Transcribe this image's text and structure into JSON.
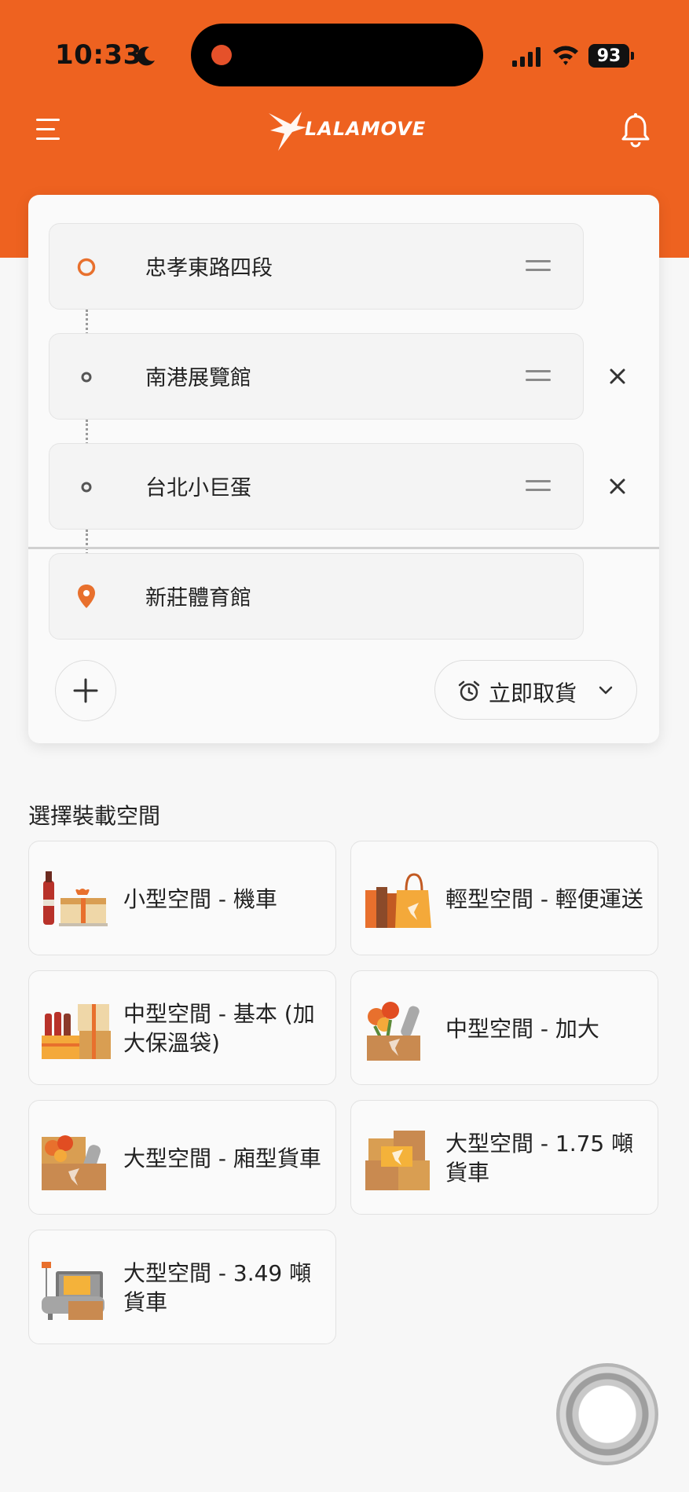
{
  "status_bar": {
    "time": "10:33",
    "battery": "93"
  },
  "header": {
    "brand": "LALAMOVE"
  },
  "route": {
    "stops": [
      {
        "label": "忠孝東路四段",
        "type": "origin",
        "removable": false
      },
      {
        "label": "南港展覽館",
        "type": "waypoint",
        "removable": true
      },
      {
        "label": "台北小巨蛋",
        "type": "waypoint",
        "removable": true
      },
      {
        "label": "新莊體育館",
        "type": "destination",
        "removable": false
      }
    ],
    "pickup_label": "立即取貨"
  },
  "vehicles": {
    "title": "選擇裝載空間",
    "items": [
      {
        "label": "小型空間 - 機車"
      },
      {
        "label": "輕型空間 - 輕便運送"
      },
      {
        "label": "中型空間 - 基本 (加大保溫袋)"
      },
      {
        "label": "中型空間 - 加大"
      },
      {
        "label": "大型空間 - 廂型貨車"
      },
      {
        "label": "大型空間 - 1.75 噸貨車"
      },
      {
        "label": "大型空間 - 3.49 噸貨車"
      }
    ]
  },
  "colors": {
    "brand": "#ee6220",
    "accent_marker": "#e8702d"
  }
}
